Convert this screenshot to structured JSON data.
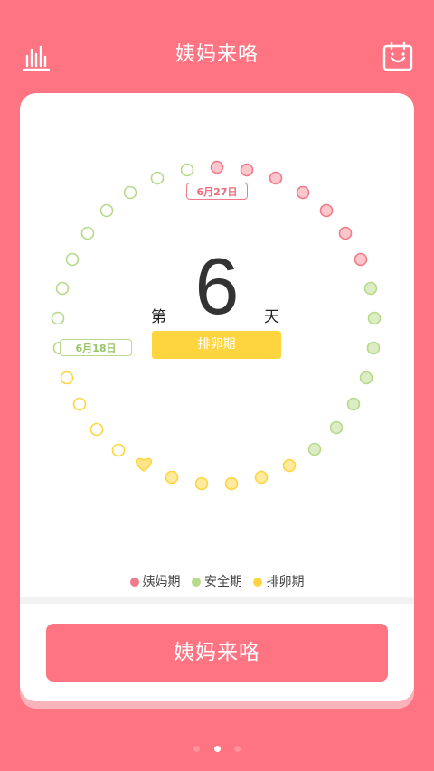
{
  "header": {
    "title": "姨妈来咯",
    "left_icon": "bar-chart-icon",
    "right_icon": "calendar-smile-icon"
  },
  "cycle": {
    "day_prefix": "第",
    "day_number": "6",
    "day_suffix": "天",
    "phase_label": "排卵期",
    "period_start_tag": "6月27日",
    "safe_start_tag": "6月18日",
    "today_marker_icon": "heart-icon"
  },
  "legend": [
    {
      "label": "姨妈期",
      "color": "#f27a88"
    },
    {
      "label": "安全期",
      "color": "#b6d98a"
    },
    {
      "label": "排卵期",
      "color": "#ffd53f"
    }
  ],
  "action_button": "姨妈来咯",
  "pagination": {
    "total": 3,
    "active": 2
  },
  "colors": {
    "background": "#ff7482",
    "card": "#ffffff",
    "period": "#f27a88",
    "safe": "#b6d98a",
    "ovulation": "#ffd53f"
  }
}
